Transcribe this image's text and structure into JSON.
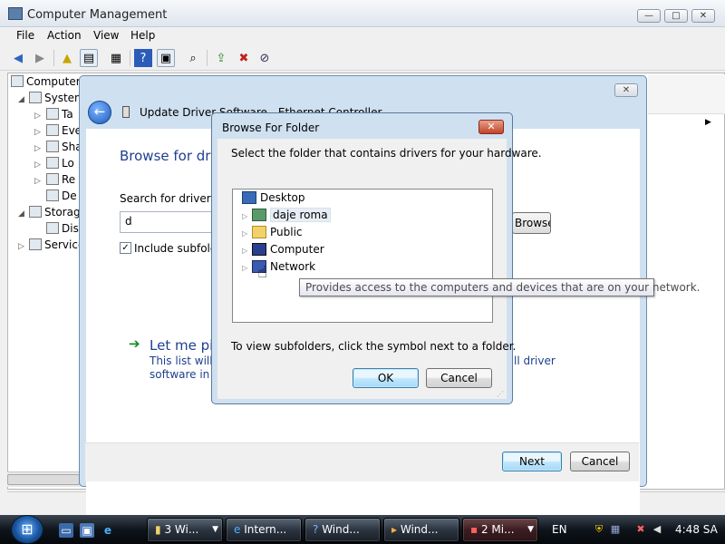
{
  "main_window": {
    "title": "Computer Management",
    "controls": {
      "minimize": "—",
      "maximize": "□",
      "close": "✕"
    },
    "menu": [
      "File",
      "Action",
      "View",
      "Help"
    ],
    "tree": {
      "root": "Computer",
      "system_tools": "Systen",
      "items": [
        "Ta",
        "Eve",
        "Sha",
        "Lo",
        "Re",
        "De"
      ],
      "storage": "Storag",
      "storage_child": "Dis",
      "services": "Service"
    }
  },
  "wizard": {
    "title": "Update Driver Software - Ethernet Controller",
    "heading": "Browse for driv",
    "search_label": "Search for driver so",
    "path_value": "d",
    "browse_label": "Browse...",
    "include_subfolders_label": "Include subfolde",
    "include_subfolders_checked": "✓",
    "pick_link": "Let me pic",
    "desc_line1": "This list will s",
    "desc_line2": "software in th",
    "desc_right": "ll driver",
    "next_label": "Next",
    "cancel_label": "Cancel"
  },
  "browse_folder": {
    "title": "Browse For Folder",
    "close_glyph": "✕",
    "instruction": "Select the folder that contains drivers for your hardware.",
    "nodes": [
      "Desktop",
      "daje roma",
      "Public",
      "Computer",
      "Network"
    ],
    "hint": "To view subfolders, click the symbol next to a folder.",
    "ok_label": "OK",
    "cancel_label": "Cancel",
    "tooltip": "Provides access to the computers and devices that are on your network."
  },
  "taskbar": {
    "tasks": [
      "3 Wi...",
      "Intern...",
      "Wind...",
      "Wind...",
      "2 Mi..."
    ],
    "language": "EN",
    "time": "4:48 SA"
  },
  "colors": {
    "accent_blue": "#1f3f8f",
    "link_green": "#1a8a2a",
    "taskbar_dark": "#0f151c"
  }
}
